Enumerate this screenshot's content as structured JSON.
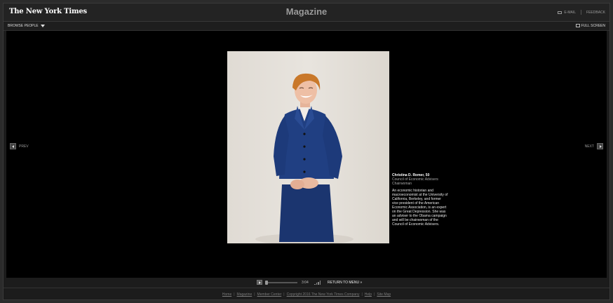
{
  "header": {
    "logo": "The New York Times",
    "section": "Magazine",
    "email_label": "E-MAIL",
    "feedback_label": "FEEDBACK"
  },
  "subbar": {
    "browse_label": "BROWSE PEOPLE",
    "fullscreen_label": "FULL SCREEN"
  },
  "nav": {
    "prev": "PREV",
    "next": "NEXT"
  },
  "caption": {
    "name": "Christina D. Romer, 50",
    "title": "Council of Economic Advisers Chairwoman",
    "body": "An economic historian and macroeconomist at the University of California, Berkeley, and former vice president of the American Economic Association, is an expert on the Great Depression. She was an adviser to the Obama campaign and will be chairwoman of the Council of Economic Advisers."
  },
  "player": {
    "time": "3:04",
    "progress": 0.0,
    "return_label": "RETURN TO MENU »"
  },
  "footer": {
    "links": [
      "Home",
      "Magazine",
      "Member Center",
      "Copyright 2016 The New York Times Company",
      "Help",
      "Site Map"
    ],
    "separator": "|"
  },
  "colors": {
    "background": "#2b2b2b",
    "stage": "#000000",
    "suit": "#1e3a78",
    "hair": "#c97a2c"
  }
}
